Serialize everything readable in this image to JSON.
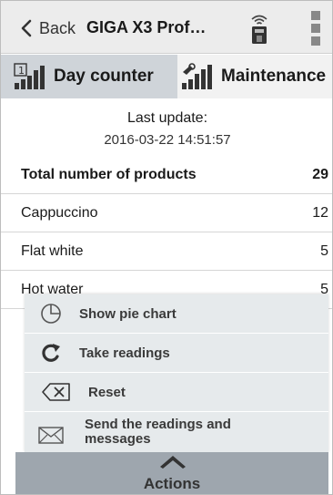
{
  "header": {
    "back_label": "Back",
    "title": "GIGA X3 Prof…",
    "back_icon": "chevron-left-icon",
    "machine_icon": "coffee-machine-wifi-icon",
    "menu_icon": "more-vertical-icon"
  },
  "tabs": [
    {
      "label": "Day counter",
      "icon": "counter-bars-icon",
      "active": true
    },
    {
      "label": "Maintenance",
      "icon": "maintenance-bars-icon",
      "active": false
    }
  ],
  "update": {
    "label": "Last update:",
    "value": "2016-03-22 14:51:57"
  },
  "rows": [
    {
      "label": "Total number of products",
      "value": "29",
      "bold": true
    },
    {
      "label": "Cappuccino",
      "value": "12"
    },
    {
      "label": "Flat white",
      "value": "5"
    },
    {
      "label": "Hot water",
      "value": "5"
    }
  ],
  "actions_menu": {
    "items": [
      {
        "label": "Show pie chart",
        "icon": "pie-chart-icon"
      },
      {
        "label": "Take readings",
        "icon": "refresh-icon"
      },
      {
        "label": "Reset",
        "icon": "backspace-icon"
      },
      {
        "label": "Send the readings and messages",
        "icon": "envelope-icon"
      }
    ]
  },
  "actions_bar": {
    "label": "Actions",
    "icon": "chevron-up-icon"
  },
  "colors": {
    "header_bg": "#ececec",
    "active_tab_bg": "#cfd4d9",
    "popup_bg": "#e6eaec",
    "actions_bar_bg": "#9ea6ae"
  }
}
